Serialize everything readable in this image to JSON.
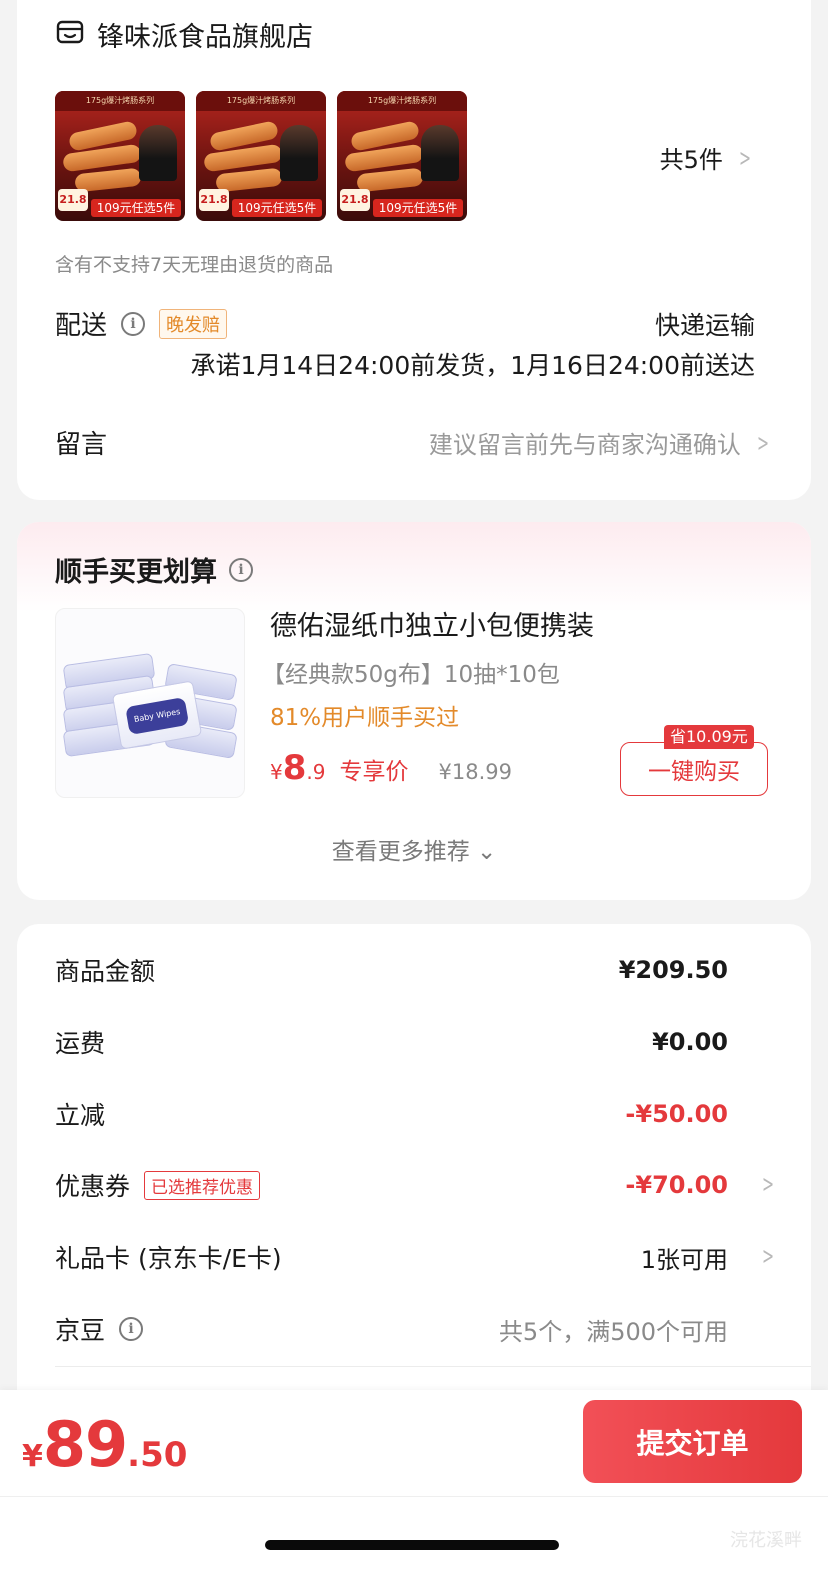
{
  "store": {
    "name": "锋味派食品旗舰店",
    "icon": "store-icon"
  },
  "products": {
    "thumb_banner": "109元任选5件",
    "thumb_price": "21.8",
    "thumb_strip": "175g爆汁烤肠系列",
    "count_label": "共5件"
  },
  "notice": "含有不支持7天无理由退货的商品",
  "delivery": {
    "label": "配送",
    "tag": "晚发赔",
    "method": "快递运输",
    "promise": "承诺1月14日24:00前发货，1月16日24:00前送达"
  },
  "message": {
    "label": "留言",
    "placeholder": "建议留言前先与商家沟通确认"
  },
  "recommend": {
    "title": "顺手买更划算",
    "item_title": "德佑湿纸巾独立小包便携装",
    "item_spec": "【经典款50g布】10抽*10包",
    "item_pct": "81%用户顺手买过",
    "price_yen": "¥",
    "price_int": "8",
    "price_dec": ".9",
    "price_tag": "专享价",
    "orig_price": "¥18.99",
    "save_badge": "省10.09元",
    "buy_label": "一键购买",
    "brand_text": "Baby Wipes",
    "more": "查看更多推荐 ⌄"
  },
  "summary": {
    "goods_label": "商品金额",
    "goods_value": "¥209.50",
    "shipping_label": "运费",
    "shipping_value": "¥0.00",
    "discount_label": "立减",
    "discount_value": "-¥50.00",
    "coupon_label": "优惠券",
    "coupon_tag": "已选推荐优惠",
    "coupon_value": "-¥70.00",
    "giftcard_label": "礼品卡 (京东卡/E卡)",
    "giftcard_value": "1张可用",
    "jingdou_label": "京豆",
    "jingdou_value": "共5个，满500个可用"
  },
  "footer": {
    "total_yen": "¥",
    "total_int": "89",
    "total_dec": ".50",
    "submit": "提交订单",
    "watermark": "浣花溪畔"
  },
  "colors": {
    "accent_red": "#e4393c",
    "orange": "#e38a2a"
  }
}
